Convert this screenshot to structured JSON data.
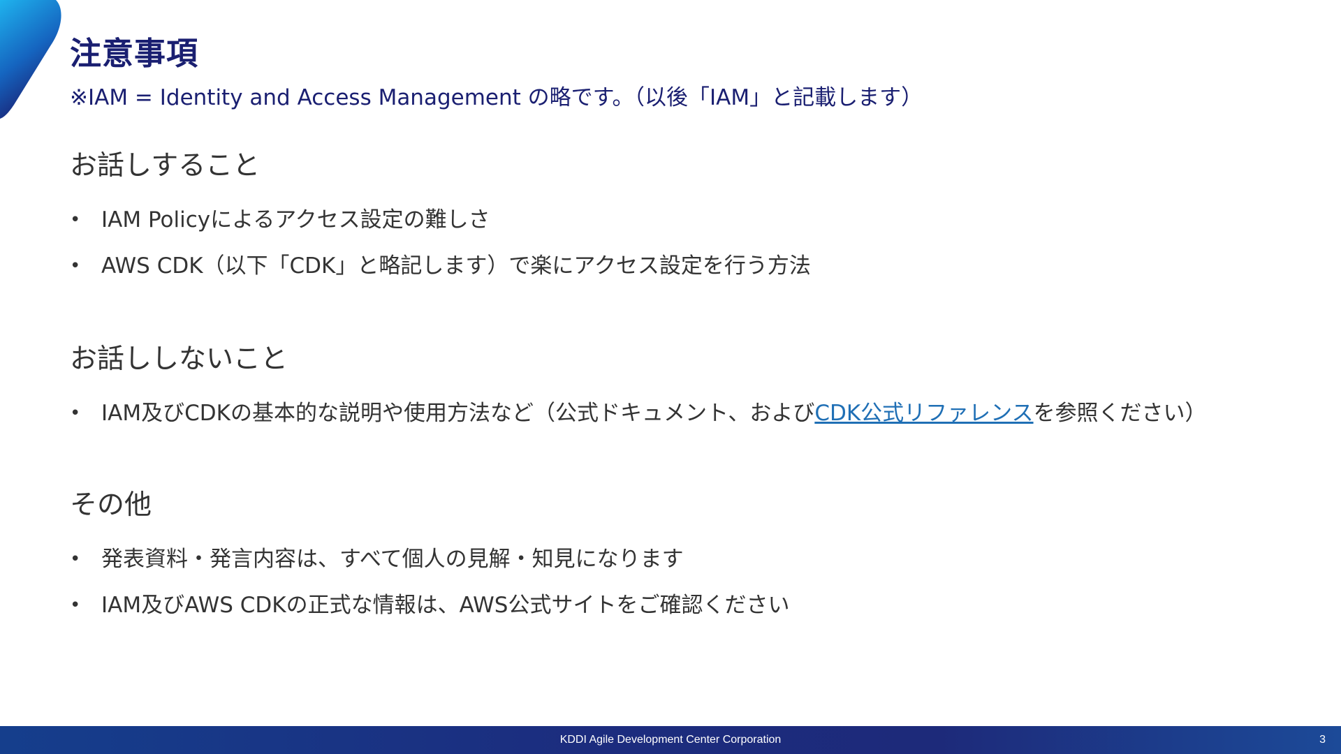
{
  "slide": {
    "title": "注意事項",
    "subtitle": "※IAM = Identity and Access Management の略です。（以後「IAM」と記載します）",
    "sections": [
      {
        "heading": "お話しすること",
        "bullets": [
          {
            "text": "IAM Policyによるアクセス設定の難しさ"
          },
          {
            "text": "AWS CDK（以下「CDK」と略記します）で楽にアクセス設定を行う方法"
          }
        ]
      },
      {
        "heading": "お話ししないこと",
        "bullets": [
          {
            "text_before": "IAM及びCDKの基本的な説明や使用方法など（公式ドキュメント、および",
            "link": "CDK公式リファレンス",
            "text_after": "を参照ください）"
          }
        ]
      },
      {
        "heading": "その他",
        "bullets": [
          {
            "text": "発表資料・発言内容は、すべて個人の見解・知見になります"
          },
          {
            "text": "IAM及びAWS CDKの正式な情報は、AWS公式サイトをご確認ください"
          }
        ]
      }
    ],
    "bullet_marker": "•"
  },
  "footer": {
    "company": "KDDI Agile Development Center Corporation",
    "page_number": "3"
  },
  "colors": {
    "title": "#1a1f71",
    "body_text": "#333333",
    "link": "#1f6fb5",
    "footer_bar": "#1d2a7a",
    "corner_accent_light": "#1aa7e8",
    "corner_accent_dark": "#1a1f71"
  }
}
